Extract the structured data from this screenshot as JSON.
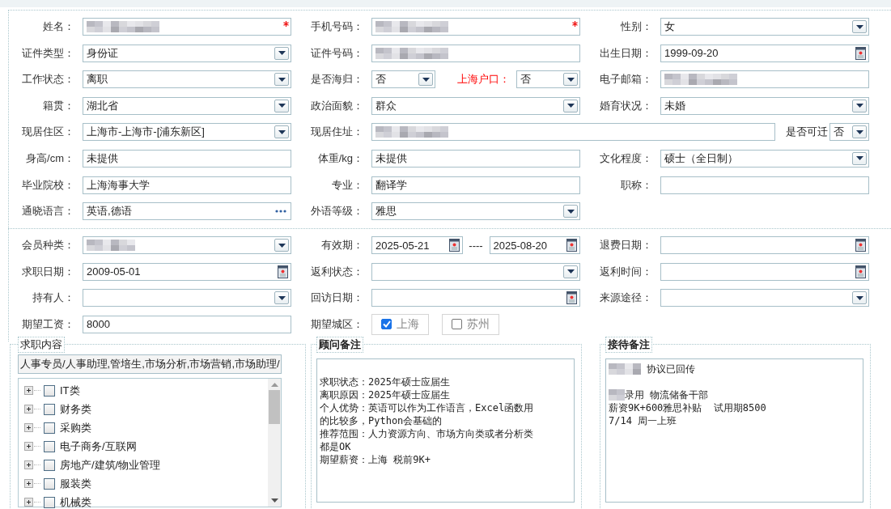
{
  "sections": [
    {
      "items": [
        {
          "label": "姓名：",
          "controls": [
            {
              "kind": "text",
              "redacted": true,
              "required": true
            }
          ]
        },
        {
          "label": "手机号码：",
          "controls": [
            {
              "kind": "text",
              "redacted": true,
              "required": true
            }
          ]
        },
        {
          "label": "性别：",
          "controls": [
            {
              "kind": "select",
              "value": "女"
            }
          ]
        },
        {
          "label": "证件类型：",
          "controls": [
            {
              "kind": "select",
              "value": "身份证"
            }
          ]
        },
        {
          "label": "证件号码：",
          "controls": [
            {
              "kind": "text",
              "redacted": true
            }
          ]
        },
        {
          "label": "出生日期：",
          "controls": [
            {
              "kind": "date",
              "value": "1999-09-20"
            }
          ]
        },
        {
          "label": "工作状态：",
          "controls": [
            {
              "kind": "select",
              "value": "离职"
            }
          ]
        },
        {
          "label": "是否海归：",
          "controls": [
            {
              "kind": "select",
              "value": "否"
            },
            {
              "kind": "label",
              "text": "上海户口：",
              "highlighted": true
            },
            {
              "kind": "select",
              "value": "否"
            }
          ]
        },
        {
          "label": "电子邮箱：",
          "controls": [
            {
              "kind": "text",
              "redacted": true
            }
          ]
        },
        {
          "label": "籍贯：",
          "controls": [
            {
              "kind": "select",
              "value": "湖北省"
            }
          ]
        },
        {
          "label": "政治面貌：",
          "controls": [
            {
              "kind": "select",
              "value": "群众"
            }
          ]
        },
        {
          "label": "婚育状况：",
          "controls": [
            {
              "kind": "select",
              "value": "未婚"
            }
          ]
        },
        {
          "label": "现居住区：",
          "controls": [
            {
              "kind": "select",
              "value": " 上海市-上海市-[浦东新区]"
            }
          ]
        },
        {
          "label": "现居住址：",
          "kind": "wide",
          "controls": [
            {
              "kind": "text",
              "redacted": true
            },
            {
              "kind": "label",
              "text": "是否可迁",
              "highlighted": false
            },
            {
              "kind": "select",
              "value": "否"
            }
          ]
        },
        {
          "label": "身高/cm：",
          "controls": [
            {
              "kind": "text",
              "value": "未提供"
            }
          ]
        },
        {
          "label": "体重/kg：",
          "controls": [
            {
              "kind": "text",
              "value": "未提供"
            }
          ]
        },
        {
          "label": "文化程度：",
          "controls": [
            {
              "kind": "select",
              "value": "硕士（全日制）"
            }
          ]
        },
        {
          "label": "毕业院校：",
          "controls": [
            {
              "kind": "text",
              "value": "上海海事大学"
            }
          ]
        },
        {
          "label": "专业：",
          "controls": [
            {
              "kind": "text",
              "value": "翻译学"
            }
          ]
        },
        {
          "label": "职称：",
          "controls": [
            {
              "kind": "text"
            }
          ]
        },
        {
          "label": "通晓语言：",
          "controls": [
            {
              "kind": "lookup",
              "value": "英语,德语"
            }
          ]
        },
        {
          "label": "外语等级：",
          "controls": [
            {
              "kind": "select",
              "value": "雅思"
            }
          ]
        }
      ]
    },
    {
      "items": [
        {
          "label": "会员种类：",
          "controls": [
            {
              "kind": "select",
              "redacted": true
            }
          ]
        },
        {
          "label": "有效期：",
          "controls": [
            {
              "kind": "date",
              "value": "2025-05-21"
            },
            {
              "kind": "separator",
              "text": "----"
            },
            {
              "kind": "date",
              "value": "2025-08-20"
            }
          ]
        },
        {
          "label": "退费日期：",
          "controls": [
            {
              "kind": "date"
            }
          ]
        },
        {
          "label": "求职日期：",
          "controls": [
            {
              "kind": "date",
              "value": "2009-05-01"
            }
          ]
        },
        {
          "label": "返利状态：",
          "controls": [
            {
              "kind": "select"
            }
          ]
        },
        {
          "label": "返利时间：",
          "controls": [
            {
              "kind": "date"
            }
          ]
        },
        {
          "label": "持有人：",
          "controls": [
            {
              "kind": "select"
            }
          ]
        },
        {
          "label": "回访日期：",
          "controls": [
            {
              "kind": "date"
            }
          ]
        },
        {
          "label": "来源途径：",
          "controls": [
            {
              "kind": "select"
            }
          ]
        },
        {
          "label": "期望工资：",
          "controls": [
            {
              "kind": "text",
              "value": "8000"
            }
          ]
        },
        {
          "label": "期望城区：",
          "controls": [
            {
              "kind": "checkbutton",
              "text": "上海",
              "checked": true
            },
            {
              "kind": "checkbutton",
              "text": "苏州",
              "checked": false
            }
          ]
        }
      ]
    }
  ],
  "job_content": {
    "legend": "求职内容",
    "selected_text": "人事专员/人事助理,管培生,市场分析,市场营销,市场助理/",
    "tree": [
      {
        "label": "IT类",
        "checked": false,
        "expanded": false
      },
      {
        "label": "财务类",
        "checked": false,
        "expanded": false
      },
      {
        "label": "采购类",
        "checked": false,
        "expanded": false
      },
      {
        "label": "电子商务/互联网",
        "checked": false,
        "expanded": false
      },
      {
        "label": "房地产/建筑/物业管理",
        "checked": false,
        "expanded": false
      },
      {
        "label": "服装类",
        "checked": false,
        "expanded": false
      },
      {
        "label": "机械类",
        "checked": false,
        "expanded": false
      }
    ]
  },
  "consultant_notes": {
    "legend": "顾问备注",
    "lines": [
      {
        "text": "求职状态：2025年硕士应届生",
        "gap_before": true
      },
      {
        "text": "离职原因：2025年硕士应届生"
      },
      {
        "text": "个人优势：英语可以作为工作语言，Excel函数用"
      },
      {
        "text": "的比较多，Python会基础的"
      },
      {
        "text": "推荐范围：人力资源方向、市场方向类或者分析类"
      },
      {
        "text": "都是OK"
      },
      {
        "text": "期望薪资：上海 税前9K+"
      }
    ]
  },
  "reception_notes": {
    "legend": "接待备注",
    "lines": [
      {
        "text": " 协议已回传",
        "redacted": true
      },
      {
        "text": "录用 物流储备干部",
        "redacted": true,
        "gap_before": true
      },
      {
        "text": "薪资9K+600雅思补贴  试用期8500"
      },
      {
        "text": "7/14 周一上班"
      }
    ]
  }
}
